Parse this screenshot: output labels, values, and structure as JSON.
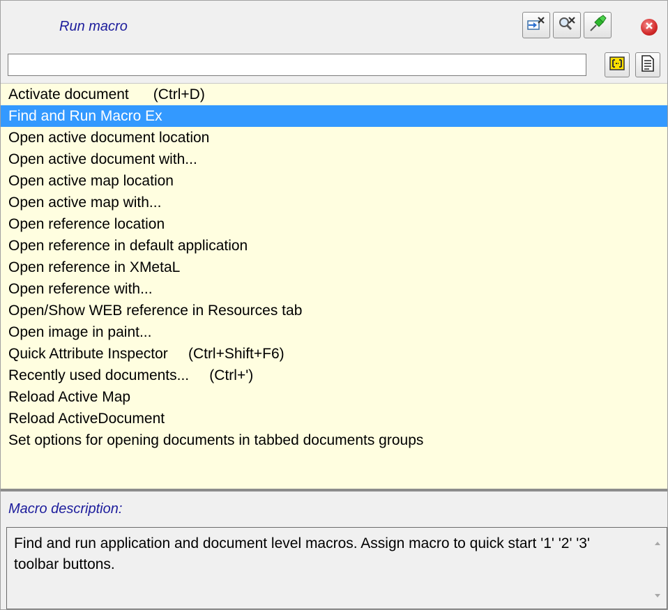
{
  "panel": {
    "title": "Run macro"
  },
  "toolbar": {
    "icons": [
      "edit-macros-icon",
      "search-options-icon",
      "pin-icon",
      "close-icon",
      "expand-icon",
      "document-icon"
    ]
  },
  "search": {
    "value": "",
    "placeholder": ""
  },
  "macros": [
    {
      "label": "Activate document      (Ctrl+D)"
    },
    {
      "label": "Find and Run Macro Ex",
      "selected": true
    },
    {
      "label": "Open active document location"
    },
    {
      "label": "Open active document with..."
    },
    {
      "label": "Open active map location"
    },
    {
      "label": "Open active map with..."
    },
    {
      "label": "Open reference location"
    },
    {
      "label": "Open reference in default application"
    },
    {
      "label": "Open reference in XMetaL"
    },
    {
      "label": "Open reference with..."
    },
    {
      "label": "Open/Show WEB reference in Resources tab"
    },
    {
      "label": "Open image in paint..."
    },
    {
      "label": "Quick Attribute Inspector     (Ctrl+Shift+F6)"
    },
    {
      "label": "Recently used documents...     (Ctrl+')"
    },
    {
      "label": "Reload Active Map"
    },
    {
      "label": "Reload ActiveDocument"
    },
    {
      "label": "Set options for opening documents in tabbed documents groups"
    }
  ],
  "description": {
    "label": "Macro description:",
    "text": "Find and run application and document level macros. Assign macro to quick start '1' '2' '3' toolbar buttons."
  },
  "colors": {
    "accent": "#1c1c9c",
    "list_bg": "#fffee0",
    "selection": "#3399ff"
  }
}
